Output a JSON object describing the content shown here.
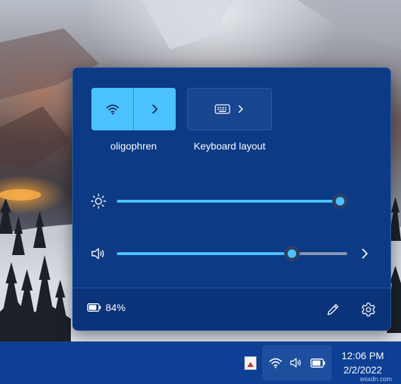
{
  "quick_settings": {
    "wifi": {
      "network_name": "oligophren",
      "active": true,
      "icon": "wifi-icon",
      "expand_icon": "chevron-right-icon"
    },
    "keyboard": {
      "label": "Keyboard layout",
      "icon": "keyboard-icon",
      "expand_icon": "chevron-right-icon"
    },
    "brightness": {
      "icon": "sun-icon",
      "level_percent": 97
    },
    "volume": {
      "icon": "speaker-icon",
      "level_percent": 76,
      "more_icon": "chevron-right-icon"
    },
    "battery": {
      "icon": "battery-icon",
      "percent_label": "84%"
    },
    "footer_buttons": {
      "edit_icon": "pencil-icon",
      "settings_icon": "gear-icon"
    }
  },
  "taskbar": {
    "tray_icons": [
      "app-icon",
      "wifi-icon",
      "speaker-icon",
      "battery-icon"
    ],
    "time": "12:06 PM",
    "date": "2/2/2022"
  },
  "watermark": "wsxdn.com",
  "colors": {
    "accent": "#4cc2ff",
    "flyout_bg": "#0c3a85",
    "taskbar_bg": "#0d3f94"
  }
}
